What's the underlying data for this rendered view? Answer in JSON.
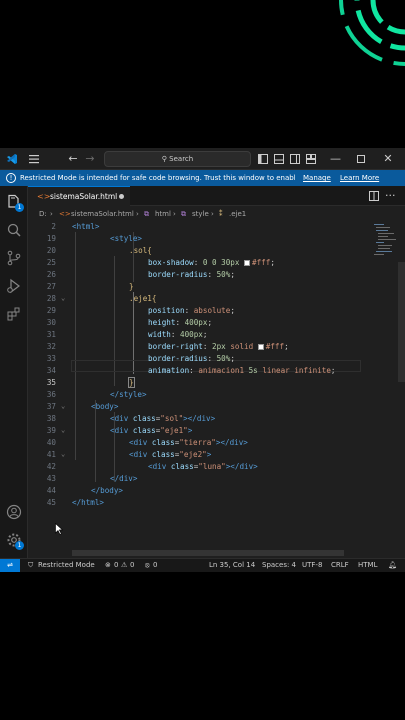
{
  "window": {
    "search_label": "Search",
    "restricted_banner": {
      "message": "Restricted Mode is intended for safe code browsing. Trust this window to enable a...",
      "manage": "Manage",
      "learn_more": "Learn More"
    }
  },
  "tab": {
    "filename": "sistemaSolar.html",
    "modified": true
  },
  "breadcrumb": {
    "folder": "D:",
    "file": "sistemaSolar.html",
    "html": "html",
    "style": "style",
    "selector": ".eje1"
  },
  "activity_badges": {
    "explorer": "1",
    "accounts": "",
    "settings": "1"
  },
  "status": {
    "mode": "Restricted Mode",
    "errors": "0",
    "warnings": "0",
    "ports": "0",
    "position": "Ln 35, Col 14",
    "spaces": "Spaces: 4",
    "encoding": "UTF-8",
    "eol": "CRLF",
    "language": "HTML"
  },
  "code": {
    "lines": [
      {
        "n": "2",
        "text": "<html>"
      },
      {
        "n": "19",
        "text": "<style>"
      },
      {
        "n": "20",
        "text": ".sol{"
      },
      {
        "n": "25",
        "text": "box-shadow: 0 0 30px #fff;"
      },
      {
        "n": "26",
        "text": "border-radius: 50%;"
      },
      {
        "n": "27",
        "text": "}"
      },
      {
        "n": "28",
        "text": ".eje1{"
      },
      {
        "n": "29",
        "text": "position: absolute;"
      },
      {
        "n": "30",
        "text": "height: 400px;"
      },
      {
        "n": "31",
        "text": "width: 400px;"
      },
      {
        "n": "32",
        "text": "border-right: 2px solid #fff;"
      },
      {
        "n": "33",
        "text": "border-radius: 50%;"
      },
      {
        "n": "34",
        "text": "animation: animacion1 5s linear infinite;"
      },
      {
        "n": "35",
        "text": "}"
      },
      {
        "n": "36",
        "text": "</style>"
      },
      {
        "n": "37",
        "text": "<body>"
      },
      {
        "n": "38",
        "text": "<div class=\"sol\"></div>"
      },
      {
        "n": "39",
        "text": "<div class=\"eje1\">"
      },
      {
        "n": "40",
        "text": "<div class=\"tierra\"></div>"
      },
      {
        "n": "41",
        "text": "<div class=\"eje2\">"
      },
      {
        "n": "42",
        "text": "<div class=\"luna\"></div>"
      },
      {
        "n": "43",
        "text": "</div>"
      },
      {
        "n": "44",
        "text": "</body>"
      },
      {
        "n": "45",
        "text": "</html>"
      }
    ]
  }
}
